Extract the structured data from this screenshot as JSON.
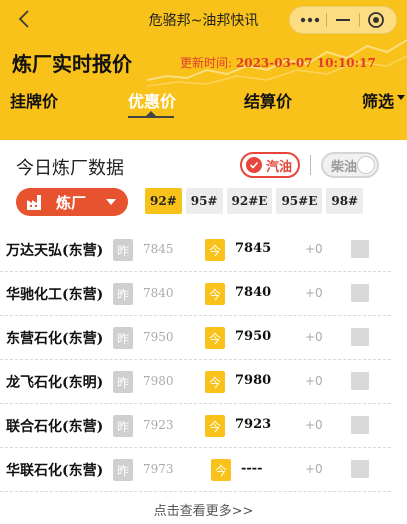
{
  "header": {
    "app_title": "危骆邦~油邦快讯",
    "main_title": "炼厂实时报价",
    "update_label": "更新时间:",
    "update_time": "2023-03-07 10:10:17"
  },
  "tabs": [
    {
      "label": "挂牌价",
      "active": false
    },
    {
      "label": "优惠价",
      "active": true
    },
    {
      "label": "结算价",
      "active": false
    },
    {
      "label": "筛选",
      "active": false
    }
  ],
  "section": {
    "title": "今日炼厂数据",
    "gasoline_label": "汽油",
    "diesel_label": "柴油",
    "refinery_label": "炼厂"
  },
  "grades": [
    "92#",
    "95#",
    "92#E",
    "95#E",
    "98#"
  ],
  "badges": {
    "yesterday": "昨",
    "today": "今"
  },
  "rows": [
    {
      "name": "万达天弘(东营)",
      "yesterday": "7845",
      "today": "7845",
      "change": "+0"
    },
    {
      "name": "华驰化工(东营)",
      "yesterday": "7840",
      "today": "7840",
      "change": "+0"
    },
    {
      "name": "东营石化(东营)",
      "yesterday": "7950",
      "today": "7950",
      "change": "+0"
    },
    {
      "name": "龙飞石化(东明)",
      "yesterday": "7980",
      "today": "7980",
      "change": "+0"
    },
    {
      "name": "联合石化(东营)",
      "yesterday": "7923",
      "today": "7923",
      "change": "+0"
    },
    {
      "name": "华联石化(东营)",
      "yesterday": "7973",
      "today": "----",
      "change": "+0"
    }
  ],
  "more_link": "点击查看更多>>",
  "colors": {
    "brand": "#f9c21a",
    "accent": "#e8532f",
    "update_text": "#e23b2a"
  }
}
